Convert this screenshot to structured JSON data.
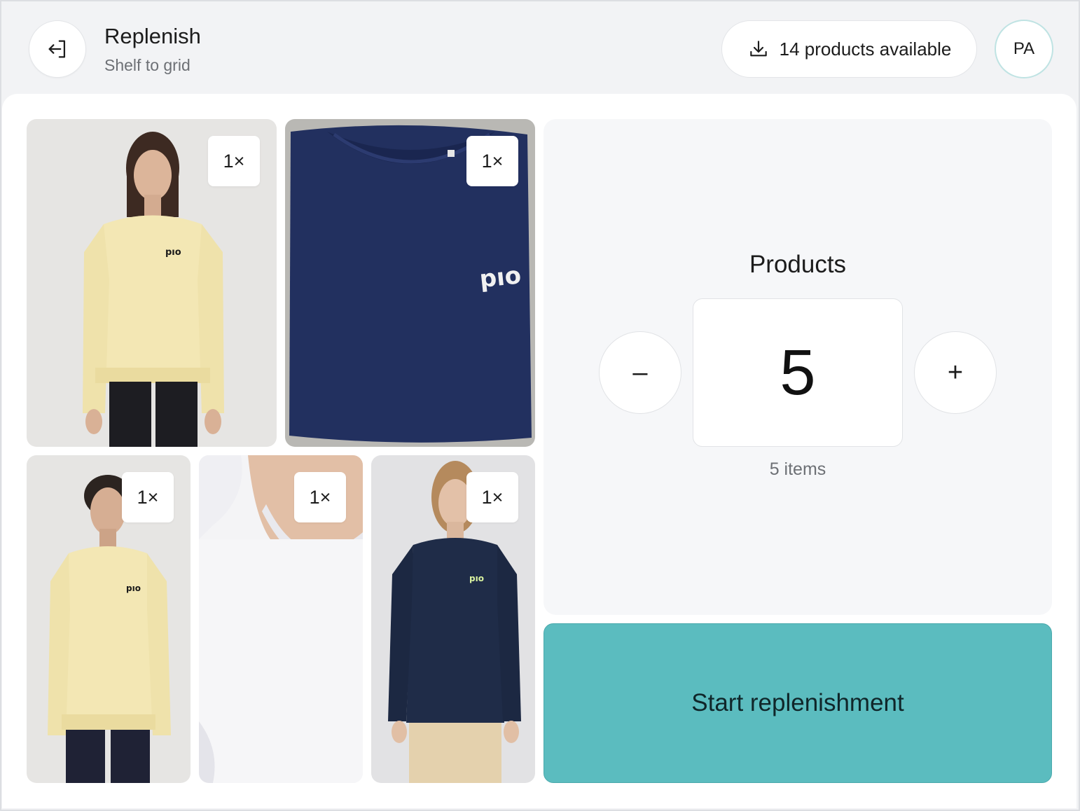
{
  "header": {
    "title": "Replenish",
    "subtitle": "Shelf to grid",
    "available_label": "14 products available",
    "avatar_initials": "PA"
  },
  "products": [
    {
      "name": "yellow-sweatshirt-woman",
      "quantity": "1×",
      "logo": "pıo"
    },
    {
      "name": "navy-sweatshirt-folded",
      "quantity": "1×",
      "logo": "pıo"
    },
    {
      "name": "yellow-sweatshirt-man",
      "quantity": "1×",
      "logo": "pıo"
    },
    {
      "name": "white-tshirt-closeup",
      "quantity": "1×",
      "logo": ""
    },
    {
      "name": "navy-sweatshirt-woman",
      "quantity": "1×",
      "logo": "pıo"
    }
  ],
  "counter": {
    "label": "Products",
    "value": "5",
    "decrement_symbol": "–",
    "increment_symbol": "+",
    "items_text": "5 items"
  },
  "actions": {
    "start_label": "Start replenishment"
  },
  "colors": {
    "accent": "#5bbcbf",
    "navy": "#1f2c5c",
    "butter_yellow": "#f3e7b4"
  }
}
